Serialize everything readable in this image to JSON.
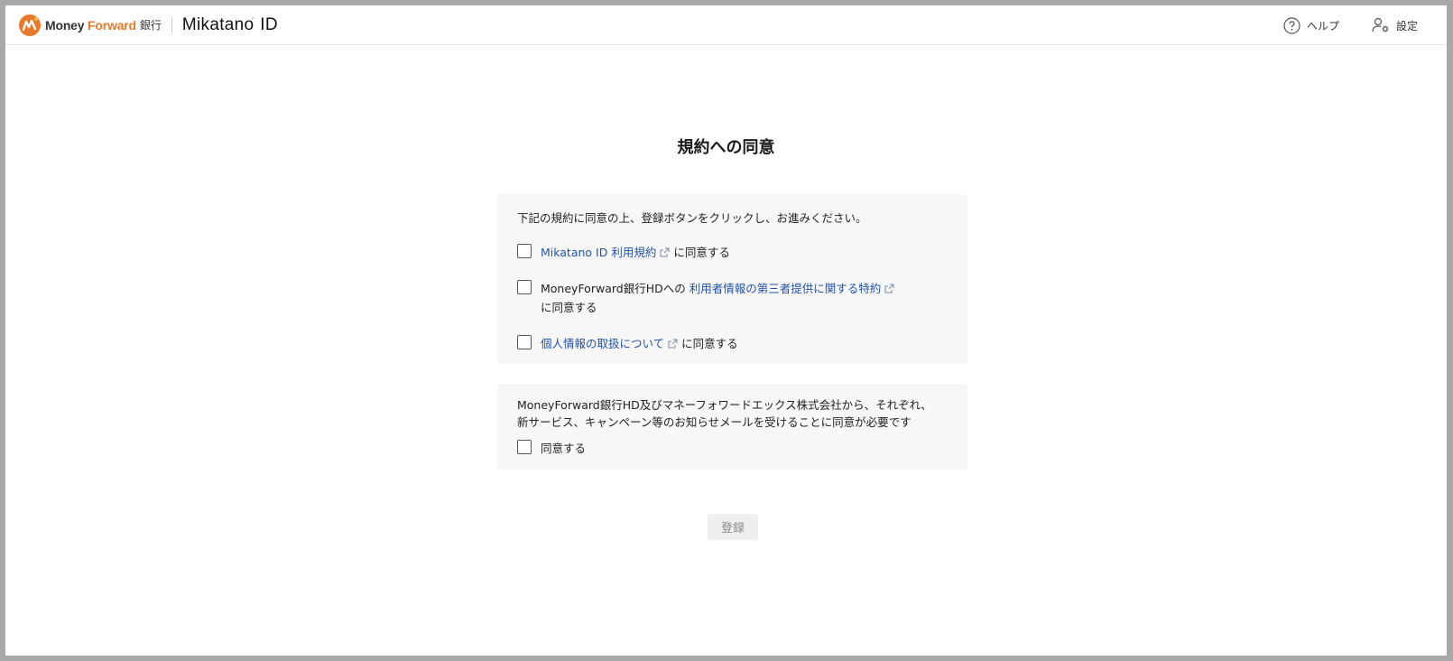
{
  "header": {
    "brand": {
      "money": "Money",
      "forward": "Forward",
      "bank": "銀行"
    },
    "product": {
      "name": "Mikatano",
      "suffix": "ID"
    },
    "help_label": "ヘルプ",
    "settings_label": "設定"
  },
  "page": {
    "title": "規約への同意",
    "intro": "下記の規約に同意の上、登録ボタンをクリックし、お進みください。"
  },
  "agreements": [
    {
      "prefix": "",
      "link": "Mikatano ID 利用規約",
      "suffix": "に同意する",
      "checked": false
    },
    {
      "prefix": "MoneyForward銀行HDへの",
      "link": "利用者情報の第三者提供に関する特約",
      "suffix": "に同意する",
      "checked": false
    },
    {
      "prefix": "",
      "link": "個人情報の取扱について",
      "suffix": "に同意する",
      "checked": false
    }
  ],
  "marketing": {
    "notice": "MoneyForward銀行HD及びマネーフォワードエックス株式会社から、それぞれ、新サービス、キャンペーン等のお知らせメールを受けることに同意が必要です",
    "agree_label": "同意する",
    "checked": false
  },
  "submit": {
    "label": "登録",
    "disabled": true
  },
  "colors": {
    "link": "#2353a8",
    "brand_accent": "#e8782a",
    "panel_bg": "#f7f7f7"
  }
}
